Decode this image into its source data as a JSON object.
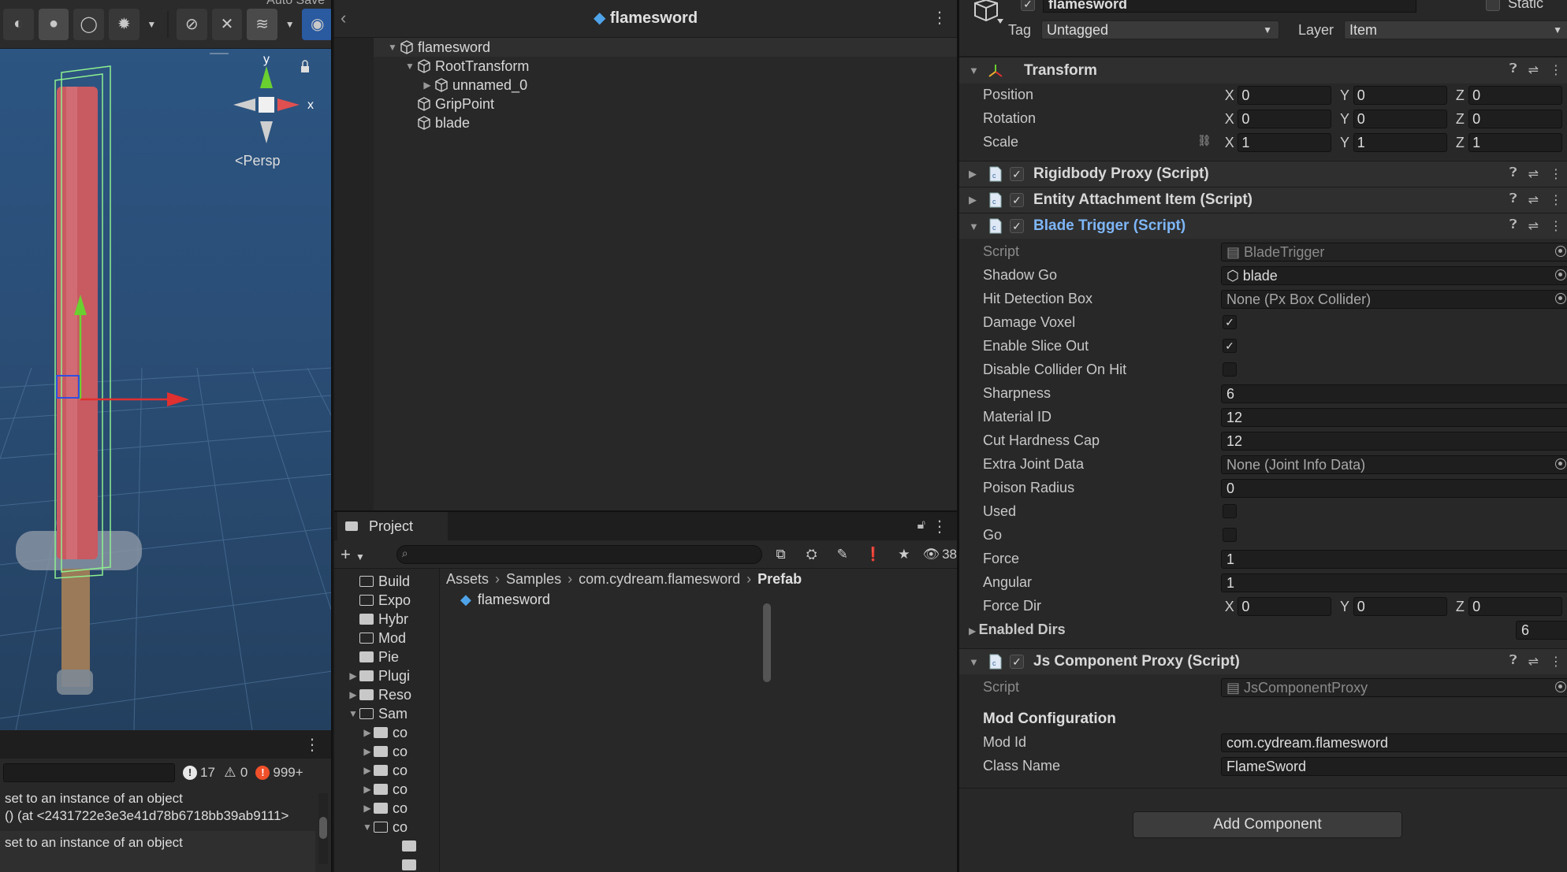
{
  "scene": {
    "autosave_label": "Auto Save",
    "persp_label": "Persp",
    "gizmo_axes": {
      "y": "y",
      "x": "x"
    }
  },
  "console": {
    "counts": {
      "info": "17",
      "warn": "0",
      "error": "999+"
    },
    "logs": [
      {
        "line1": "set to an instance of an object",
        "line2": "() (at <2431722e3e3e41d78b6718bb39ab9111>"
      },
      {
        "line1": "set to an instance of an object",
        "line2": ""
      }
    ]
  },
  "hierarchy": {
    "title": "flamesword",
    "items": [
      {
        "label": "flamesword",
        "depth": 0,
        "expanded": true
      },
      {
        "label": "RootTransform",
        "depth": 1,
        "expanded": true
      },
      {
        "label": "unnamed_0",
        "depth": 2,
        "expanded": false
      },
      {
        "label": "GripPoint",
        "depth": 1,
        "expanded": null
      },
      {
        "label": "blade",
        "depth": 1,
        "expanded": null
      }
    ]
  },
  "project": {
    "tab_label": "Project",
    "hidden_count": "38",
    "folders": [
      {
        "label": "Build",
        "filled": false,
        "arrow": ""
      },
      {
        "label": "Expo",
        "filled": false,
        "arrow": ""
      },
      {
        "label": "Hybr",
        "filled": true,
        "arrow": ""
      },
      {
        "label": "Mod",
        "filled": false,
        "arrow": ""
      },
      {
        "label": "Pie",
        "filled": true,
        "arrow": ""
      },
      {
        "label": "Plugi",
        "filled": true,
        "arrow": "▶"
      },
      {
        "label": "Reso",
        "filled": true,
        "arrow": "▶"
      },
      {
        "label": "Sam",
        "filled": false,
        "arrow": "▼"
      },
      {
        "label": "co",
        "filled": true,
        "arrow": "▶",
        "indent": true
      },
      {
        "label": "co",
        "filled": true,
        "arrow": "▶",
        "indent": true
      },
      {
        "label": "co",
        "filled": true,
        "arrow": "▶",
        "indent": true
      },
      {
        "label": "co",
        "filled": true,
        "arrow": "▶",
        "indent": true
      },
      {
        "label": "co",
        "filled": true,
        "arrow": "▶",
        "indent": true
      },
      {
        "label": "co",
        "filled": false,
        "arrow": "▼",
        "indent": true
      },
      {
        "label": "",
        "filled": true,
        "arrow": "",
        "indent2": true
      },
      {
        "label": "",
        "filled": true,
        "arrow": "",
        "indent2": true
      }
    ],
    "breadcrumb": [
      "Assets",
      "Samples",
      "com.cydream.flamesword",
      "Prefab"
    ],
    "assets": [
      "flamesword"
    ]
  },
  "inspector": {
    "go_name": "flamesword",
    "static_label": "Static",
    "tag_label": "Tag",
    "tag_value": "Untagged",
    "layer_label": "Layer",
    "layer_value": "Item",
    "transform": {
      "title": "Transform",
      "position": {
        "label": "Position",
        "x": "0",
        "y": "0",
        "z": "0"
      },
      "rotation": {
        "label": "Rotation",
        "x": "0",
        "y": "0",
        "z": "0"
      },
      "scale": {
        "label": "Scale",
        "x": "1",
        "y": "1",
        "z": "1"
      }
    },
    "components_collapsed": [
      "Rigidbody Proxy (Script)",
      "Entity Attachment Item (Script)"
    ],
    "blade_trigger": {
      "title": "Blade Trigger (Script)",
      "script_label": "Script",
      "script_value": "BladeTrigger",
      "shadow_go_label": "Shadow Go",
      "shadow_go_value": "blade",
      "hit_box_label": "Hit Detection Box",
      "hit_box_value": "None (Px Box Collider)",
      "damage_voxel_label": "Damage Voxel",
      "damage_voxel": true,
      "enable_slice_label": "Enable Slice Out",
      "enable_slice": true,
      "disable_collider_label": "Disable Collider On Hit",
      "disable_collider": false,
      "sharpness_label": "Sharpness",
      "sharpness": "6",
      "material_id_label": "Material ID",
      "material_id": "12",
      "cut_hardness_label": "Cut Hardness Cap",
      "cut_hardness": "12",
      "extra_joint_label": "Extra Joint Data",
      "extra_joint": "None (Joint Info Data)",
      "poison_radius_label": "Poison Radius",
      "poison_radius": "0",
      "used_label": "Used",
      "used": false,
      "go_label": "Go",
      "go": false,
      "force_label": "Force",
      "force": "1",
      "angular_label": "Angular",
      "angular": "1",
      "force_dir_label": "Force Dir",
      "force_dir": {
        "x": "0",
        "y": "0",
        "z": "0"
      },
      "enabled_dirs_label": "Enabled Dirs",
      "enabled_dirs": "6"
    },
    "js_proxy": {
      "title": "Js Component Proxy (Script)",
      "script_label": "Script",
      "script_value": "JsComponentProxy",
      "section": "Mod Configuration",
      "mod_id_label": "Mod Id",
      "mod_id": "com.cydream.flamesword",
      "class_name_label": "Class Name",
      "class_name": "FlameSword"
    },
    "add_component_label": "Add Component",
    "axis_labels": {
      "x": "X",
      "y": "Y",
      "z": "Z"
    }
  },
  "colors": {
    "scene_bg": "#2a4a6e",
    "panel_bg": "#282828",
    "accent_blue": "#7eb6f7",
    "sword_blade": "#c85a62",
    "gizmo_x": "#e03030",
    "gizmo_y": "#6ad030",
    "gizmo_z": "#3050e0"
  }
}
